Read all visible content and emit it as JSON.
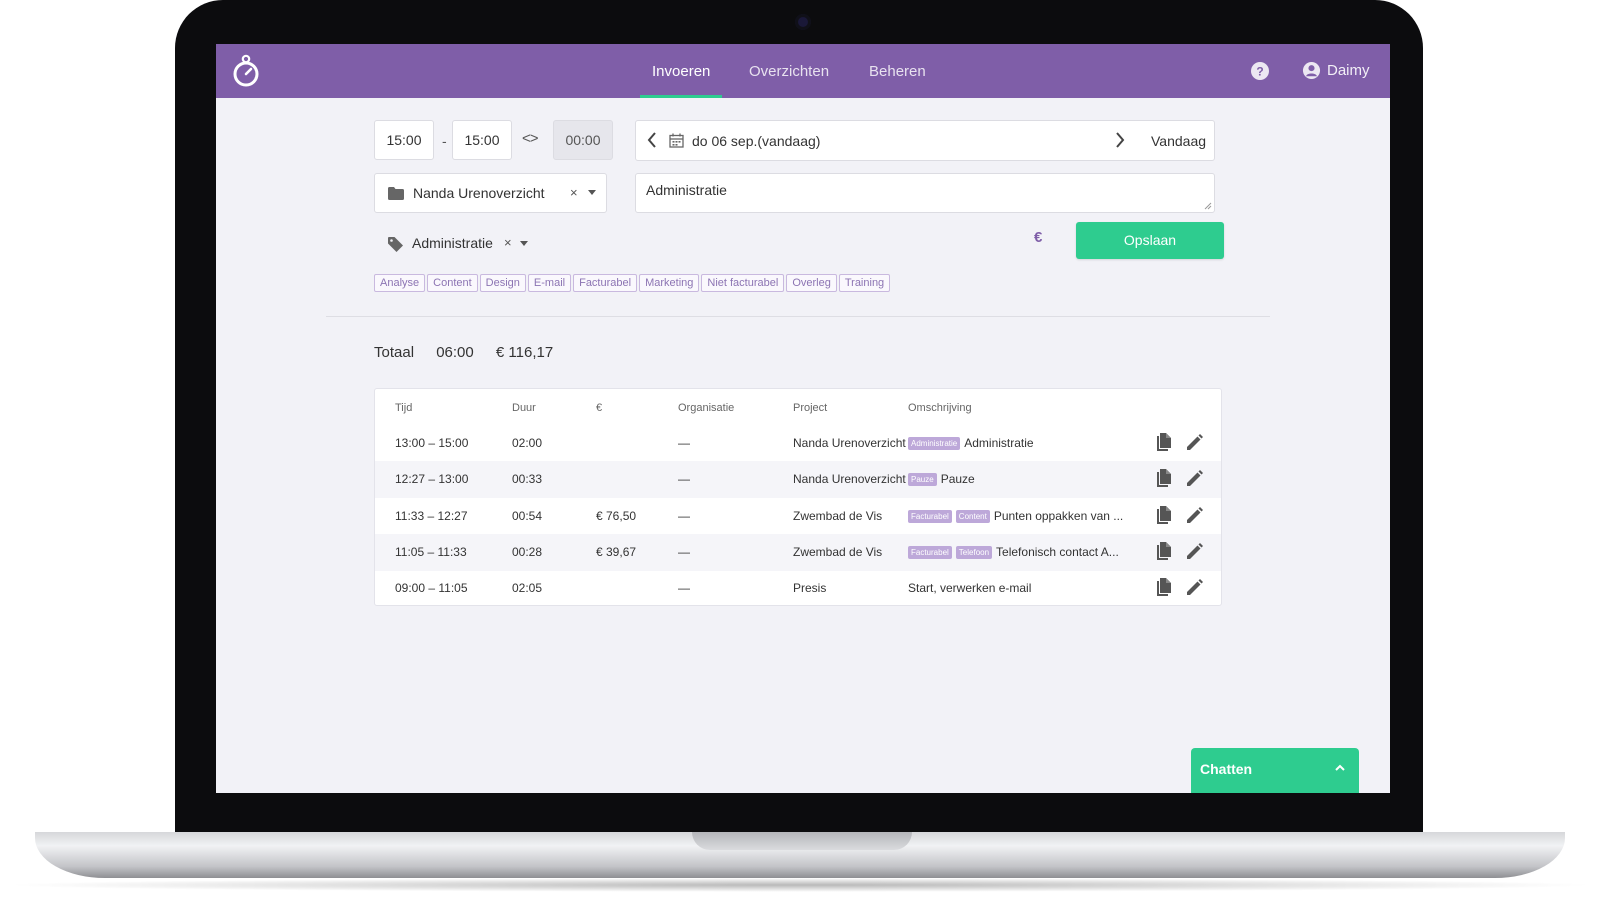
{
  "nav": {
    "items": [
      {
        "label": "Invoeren",
        "active": true
      },
      {
        "label": "Overzichten",
        "active": false
      },
      {
        "label": "Beheren",
        "active": false
      }
    ],
    "user": "Daimy",
    "icons": {
      "logo": "stopwatch-icon",
      "help": "question-circle-icon",
      "user": "user-circle-icon"
    }
  },
  "entry": {
    "start_time": "15:00",
    "separator": "-",
    "end_time": "15:00",
    "swap_symbol": "<>",
    "duration": "00:00",
    "date": "do 06 sep.(vandaag)",
    "today_label": "Vandaag",
    "project": "Nanda Urenoverzicht",
    "clear_symbol": "×",
    "description": "Administratie",
    "tag": "Administratie",
    "euro_symbol": "€",
    "save_label": "Opslaan"
  },
  "tag_options": [
    "Analyse",
    "Content",
    "Design",
    "E-mail",
    "Facturabel",
    "Marketing",
    "Niet facturabel",
    "Overleg",
    "Training"
  ],
  "totals": {
    "label": "Totaal",
    "hours": "06:00",
    "amount": "€ 116,17"
  },
  "table": {
    "headers": {
      "time": "Tijd",
      "duration": "Duur",
      "amount": "€",
      "organisation": "Organisatie",
      "project": "Project",
      "description": "Omschrijving"
    },
    "rows": [
      {
        "time": "13:00 – 15:00",
        "duration": "02:00",
        "amount": "",
        "organisation": "—",
        "project": "Nanda Urenoverzicht",
        "tags": [
          "Administratie"
        ],
        "description": "Administratie"
      },
      {
        "time": "12:27 – 13:00",
        "duration": "00:33",
        "amount": "",
        "organisation": "—",
        "project": "Nanda Urenoverzicht",
        "tags": [
          "Pauze"
        ],
        "description": "Pauze"
      },
      {
        "time": "11:33 – 12:27",
        "duration": "00:54",
        "amount": "€ 76,50",
        "organisation": "—",
        "project": "Zwembad de Vis",
        "tags": [
          "Facturabel",
          "Content"
        ],
        "description": "Punten oppakken van ..."
      },
      {
        "time": "11:05 – 11:33",
        "duration": "00:28",
        "amount": "€ 39,67",
        "organisation": "—",
        "project": "Zwembad de Vis",
        "tags": [
          "Facturabel",
          "Telefoon"
        ],
        "description": "Telefonisch contact A..."
      },
      {
        "time": "09:00 – 11:05",
        "duration": "02:05",
        "amount": "",
        "organisation": "—",
        "project": "Presis",
        "tags": [],
        "description": "Start, verwerken e-mail"
      }
    ]
  },
  "chat": {
    "label": "Chatten"
  },
  "colors": {
    "brand": "#7f5ea8",
    "accent": "#2ecc8f"
  }
}
